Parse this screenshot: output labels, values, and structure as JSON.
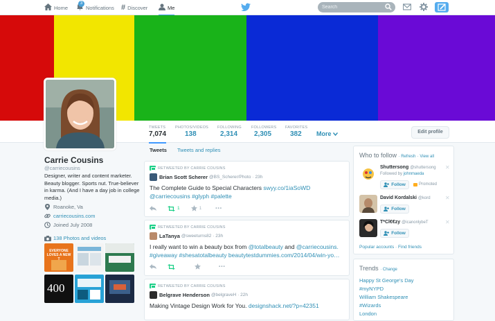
{
  "nav": {
    "home": "Home",
    "notifications": "Notifications",
    "notifications_count": "3",
    "discover": "Discover",
    "me": "Me",
    "search_placeholder": "Search"
  },
  "header": {
    "colors": [
      "#d60a0a",
      "#f2e600",
      "#19b319",
      "#0a2ad6",
      "#6a0ad6"
    ]
  },
  "stats": [
    {
      "label": "TWEETS",
      "value": "7,074"
    },
    {
      "label": "PHOTOS/VIDEOS",
      "value": "138"
    },
    {
      "label": "FOLLOWING",
      "value": "2,314"
    },
    {
      "label": "FOLLOWERS",
      "value": "2,305"
    },
    {
      "label": "FAVORITES",
      "value": "382"
    }
  ],
  "more_label": "More",
  "edit_profile": "Edit profile",
  "profile": {
    "name": "Carrie Cousins",
    "handle": "@carriecousins",
    "bio": "Designer, writer and content marketer. Beauty blogger. Sports nut. True-believer in karma. (And I have a day job in college media.)",
    "location": "Roanoke, Va",
    "website": "carriecousins.com",
    "joined": "Joined July 2008",
    "photos_link": "138 Photos and videos",
    "thumb_400": "400",
    "thumb_orange": "EVERYONE LOVES A NEW T"
  },
  "stream_tabs": [
    "Tweets",
    "Tweets and replies"
  ],
  "tweets": [
    {
      "retweeted_by": "RETWEETED BY CARRIE COUSINS",
      "author": "Brian Scott Scherer",
      "handle": "@BS_Scherer/Photo",
      "time": "· 23h",
      "text_plain": "The Complete Guide to Special Characters ",
      "link1": "swyy.co/1iaSoWD",
      "link2": "@carriecousins",
      "link3": "#glyph",
      "link4": "#palette",
      "retweets": "1",
      "favorites": "1"
    },
    {
      "retweeted_by": "RETWEETED BY CARRIE COUSINS",
      "author": "LaTanya",
      "handle": "@sweeturns82",
      "time": "· 23h",
      "text_plain": "I really want to win a beauty box from ",
      "link1": "@totalbeauty",
      "and": " and ",
      "link2": "@carriecousins.",
      "link3": "#giveaway",
      "link4": "#shesatotalbeauty",
      "link5": "beautytestdummies.com/2014/04/win-yo…"
    },
    {
      "retweeted_by": "RETWEETED BY CARRIE COUSINS",
      "author": "Belgrave Henderson",
      "handle": "@belgraveH",
      "time": "· 22h",
      "text_plain": "Making Vintage Design Work for You. ",
      "link1": "designshack.net/?p=42351"
    }
  ],
  "who_to_follow": {
    "title": "Who to follow",
    "refresh": "· Refresh",
    "view_all": "· View all",
    "follow_label": "Follow",
    "promoted": "Promoted",
    "popular": "Popular accounts",
    "find_friends": "· Find friends",
    "users": [
      {
        "name": "Shuttersong",
        "handle": "@shuttersong",
        "followed_by": "Followed by ",
        "followed_by_name": "johnmaeda"
      },
      {
        "name": "David Kordalski",
        "handle": "@kord"
      },
      {
        "name": "T*Cl€€zy",
        "handle": "@icanonlybeT"
      }
    ]
  },
  "trends": {
    "title": "Trends",
    "change": "· Change",
    "items": [
      "Happy St George's Day",
      "#myNYPD",
      "William Shakespeare",
      "#Wizards",
      "London"
    ]
  }
}
